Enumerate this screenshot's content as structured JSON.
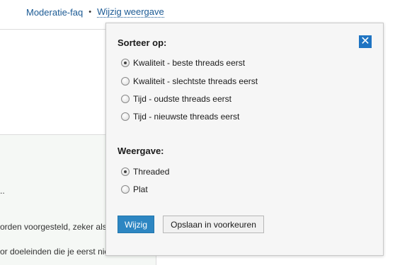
{
  "breadcrumb": {
    "items": [
      "Moderatie-faq",
      "Wijzig weergave"
    ],
    "separator": "•"
  },
  "background": {
    "lines": [
      "..",
      "orden voorgesteld, zeker als",
      "or doeleinden die je eerst nie"
    ]
  },
  "popup": {
    "close_icon": "close-icon",
    "sort_title": "Sorteer op:",
    "sort_options": [
      {
        "label": "Kwaliteit - beste threads eerst",
        "checked": true
      },
      {
        "label": "Kwaliteit - slechtste threads eerst",
        "checked": false
      },
      {
        "label": "Tijd - oudste threads eerst",
        "checked": false
      },
      {
        "label": "Tijd - nieuwste threads eerst",
        "checked": false
      }
    ],
    "view_title": "Weergave:",
    "view_options": [
      {
        "label": "Threaded",
        "checked": true
      },
      {
        "label": "Plat",
        "checked": false
      }
    ],
    "apply_label": "Wijzig",
    "save_label": "Opslaan in voorkeuren"
  },
  "colors": {
    "link": "#1b5a94",
    "accent": "#1f74c2",
    "button_primary": "#2d86c2",
    "popup_bg": "#f6f6f6"
  }
}
